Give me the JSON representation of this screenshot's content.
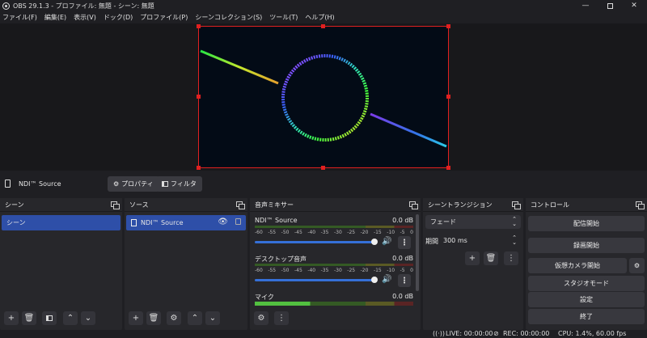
{
  "window": {
    "title": "OBS 29.1.3 - プロファイル: 無題 - シーン: 無題"
  },
  "menu": [
    "ファイル(F)",
    "編集(E)",
    "表示(V)",
    "ドック(D)",
    "プロファイル(P)",
    "シーンコレクション(S)",
    "ツール(T)",
    "ヘルプ(H)"
  ],
  "source_toolbar": {
    "source_name": "NDI™ Source",
    "properties": "プロパティ",
    "filters": "フィルタ"
  },
  "docks": {
    "scenes": {
      "title": "シーン",
      "items": [
        "シーン"
      ]
    },
    "sources": {
      "title": "ソース",
      "items": [
        "NDI™ Source"
      ]
    },
    "mixer": {
      "title": "音声ミキサー",
      "scale": [
        "-60",
        "-55",
        "-50",
        "-45",
        "-40",
        "-35",
        "-30",
        "-25",
        "-20",
        "-15",
        "-10",
        "-5",
        "0"
      ],
      "channels": [
        {
          "name": "NDI™ Source",
          "db": "0.0 dB",
          "volume": 1.0
        },
        {
          "name": "デスクトップ音声",
          "db": "0.0 dB",
          "volume": 1.0
        },
        {
          "name": "マイク",
          "db": "0.0 dB",
          "volume": 1.0
        }
      ]
    },
    "transitions": {
      "title": "シーントランジション",
      "transition": "フェード",
      "duration_label": "期間",
      "duration": "300 ms"
    },
    "controls": {
      "title": "コントロール",
      "buttons": [
        "配信開始",
        "録画開始",
        "仮想カメラ開始",
        "スタジオモード",
        "設定",
        "終了"
      ]
    }
  },
  "status": {
    "live": "LIVE: 00:00:00",
    "rec": "REC: 00:00:00",
    "cpu": "CPU: 1.4%, 60.00 fps"
  }
}
